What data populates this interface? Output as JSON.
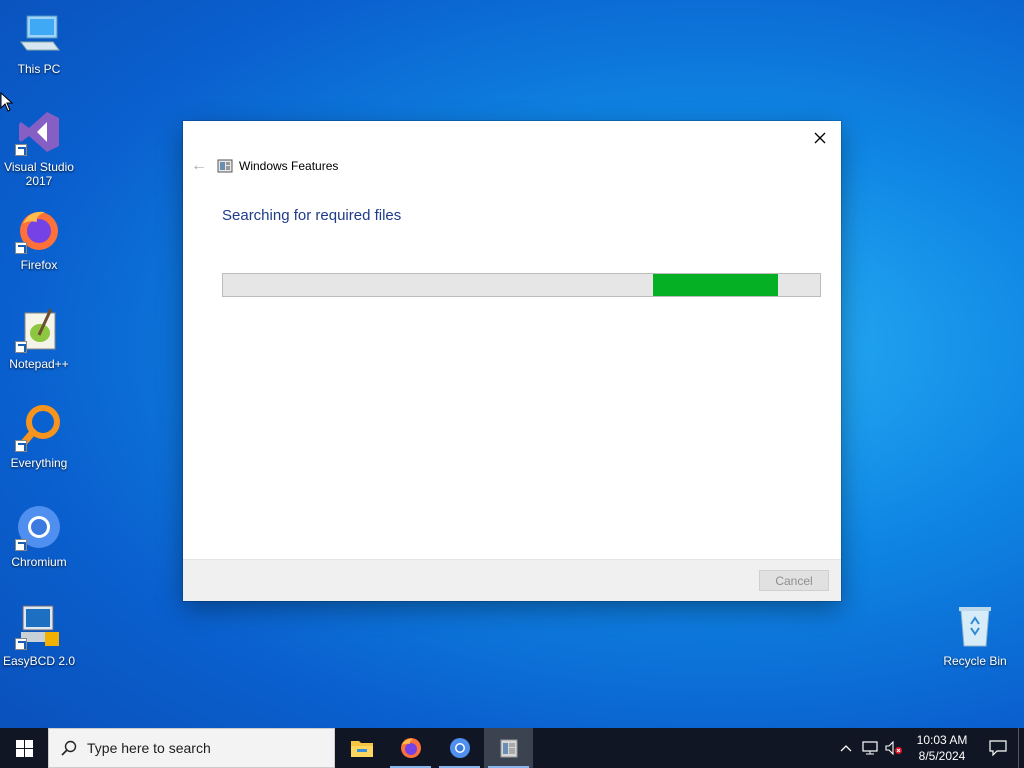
{
  "desktop": {
    "icons": [
      {
        "label": "This PC",
        "icon": "computer-icon"
      },
      {
        "label": "Visual Studio 2017",
        "icon": "visual-studio-icon"
      },
      {
        "label": "Firefox",
        "icon": "firefox-icon"
      },
      {
        "label": "Notepad++",
        "icon": "notepadpp-icon"
      },
      {
        "label": "Everything",
        "icon": "everything-icon"
      },
      {
        "label": "Chromium",
        "icon": "chromium-icon"
      },
      {
        "label": "EasyBCD 2.0",
        "icon": "easybcd-icon"
      },
      {
        "label": "Recycle Bin",
        "icon": "recycle-bin-icon"
      }
    ]
  },
  "dialog": {
    "title": "Windows Features",
    "heading": "Searching for required files",
    "progress": {
      "start": 0.72,
      "end": 0.93,
      "state": "indeterminate"
    },
    "cancel_label": "Cancel",
    "accent_color": "#06b025"
  },
  "taskbar": {
    "search_placeholder": "Type here to search",
    "apps": [
      "file-explorer-icon",
      "firefox-icon",
      "chromium-icon",
      "windows-features-icon"
    ],
    "clock": {
      "time": "10:03 AM",
      "date": "8/5/2024"
    }
  }
}
